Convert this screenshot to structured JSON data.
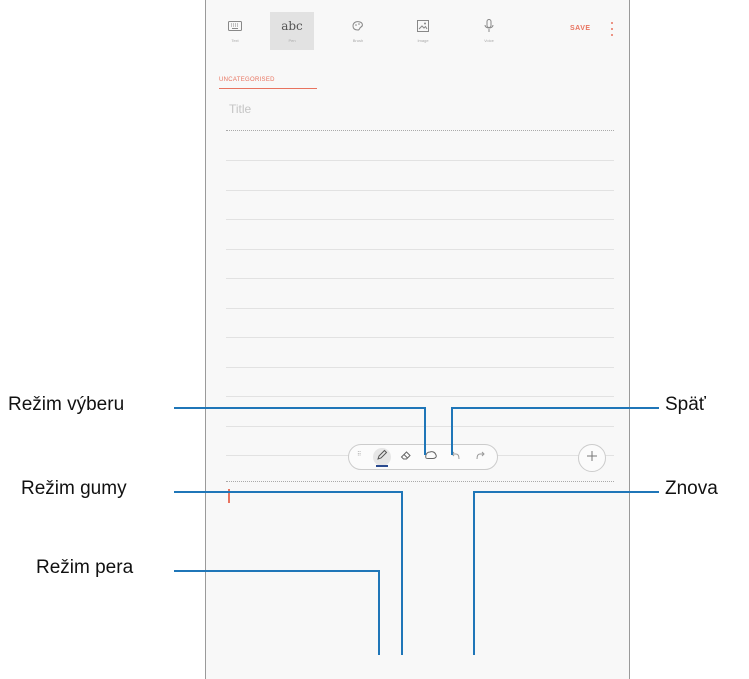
{
  "toolbar": {
    "tools": [
      {
        "label": "Text",
        "icon": "keyboard-icon"
      },
      {
        "label": "abc",
        "sub": "Pen",
        "icon": "pen-text-icon"
      },
      {
        "label": "Brush",
        "icon": "brush-icon"
      },
      {
        "label": "Image",
        "icon": "image-icon"
      },
      {
        "label": "Voice",
        "icon": "mic-icon"
      }
    ],
    "save_label": "SAVE",
    "more_icon": "more-vert-icon"
  },
  "note": {
    "category": "UNCATEGORISED",
    "title_placeholder": "Title"
  },
  "pen_toolbar": {
    "tools": [
      "pen-icon",
      "eraser-icon",
      "selection-icon",
      "undo-icon",
      "redo-icon"
    ],
    "add_icon": "plus-icon"
  },
  "callouts": {
    "selection_mode": "Režim výberu",
    "eraser_mode": "Režim gumy",
    "pen_mode": "Režim pera",
    "undo": "Späť",
    "redo": "Znova"
  },
  "colors": {
    "accent": "#e8735f",
    "callout_line": "#1f76b8",
    "pen_active": "#2a4a8f"
  }
}
